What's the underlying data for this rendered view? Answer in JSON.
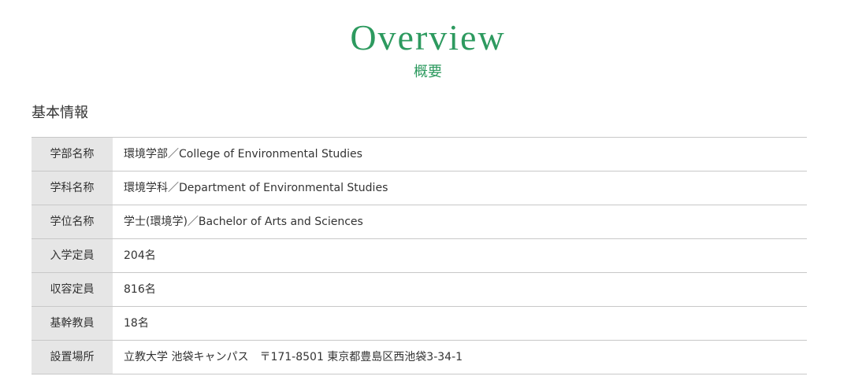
{
  "hero": {
    "title": "Overview",
    "subtitle": "概要"
  },
  "section": {
    "heading": "基本情報"
  },
  "colors": {
    "accent": "#2d9a5f",
    "header_cell_bg": "#e6e6e6",
    "border": "#c8c8c8"
  },
  "table": {
    "rows": [
      {
        "label": "学部名称",
        "value": "環境学部／College of Environmental Studies"
      },
      {
        "label": "学科名称",
        "value": "環境学科／Department of Environmental Studies"
      },
      {
        "label": "学位名称",
        "value": "学士(環境学)／Bachelor of Arts and Sciences"
      },
      {
        "label": "入学定員",
        "value": "204名"
      },
      {
        "label": "収容定員",
        "value": "816名"
      },
      {
        "label": "基幹教員",
        "value": "18名"
      },
      {
        "label": "設置場所",
        "value": "立教大学 池袋キャンパス　〒171-8501 東京都豊島区西池袋3-34-1"
      }
    ]
  }
}
